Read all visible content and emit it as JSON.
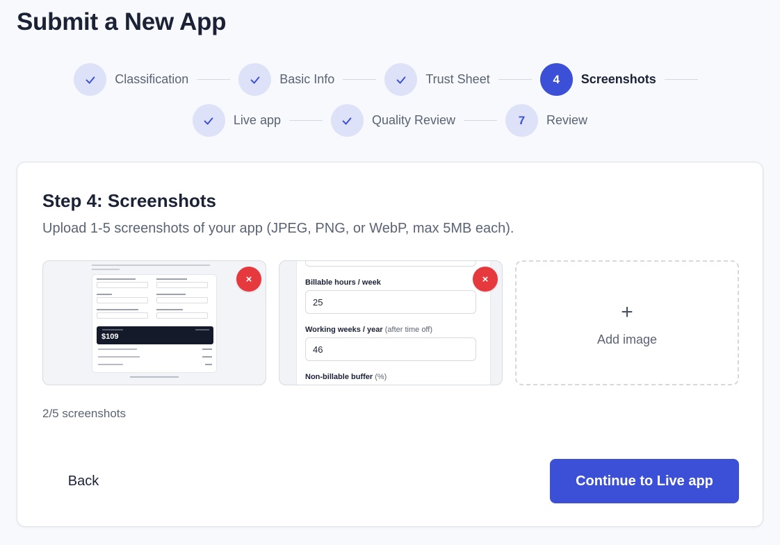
{
  "page": {
    "title": "Submit a New App"
  },
  "stepper": {
    "row1": [
      {
        "number": "",
        "label": "Classification",
        "state": "done"
      },
      {
        "number": "",
        "label": "Basic Info",
        "state": "done"
      },
      {
        "number": "",
        "label": "Trust Sheet",
        "state": "done"
      },
      {
        "number": "4",
        "label": "Screenshots",
        "state": "active"
      }
    ],
    "row2": [
      {
        "number": "",
        "label": "Live app",
        "state": "done"
      },
      {
        "number": "",
        "label": "Quality Review",
        "state": "done"
      },
      {
        "number": "7",
        "label": "Review",
        "state": "pending"
      }
    ]
  },
  "card": {
    "heading": "Step 4: Screenshots",
    "description": "Upload 1-5 screenshots of your app (JPEG, PNG, or WebP, max 5MB each).",
    "remove_icon": "×",
    "thumbnail1": {
      "big_value": "$109"
    },
    "thumbnail2": {
      "field1_label": "Billable hours / week",
      "field1_value": "25",
      "field2_label": "Working weeks / year",
      "field2_hint": "(after time off)",
      "field2_value": "46",
      "field3_label": "Non-billable buffer",
      "field3_hint": "(%)"
    },
    "add_tile": {
      "plus": "+",
      "label": "Add image"
    },
    "count": "2/5 screenshots",
    "back_label": "Back",
    "continue_label": "Continue to Live app"
  },
  "colors": {
    "accent": "#3b50d6",
    "accent_light": "#dde2f8",
    "danger": "#e5393e"
  }
}
